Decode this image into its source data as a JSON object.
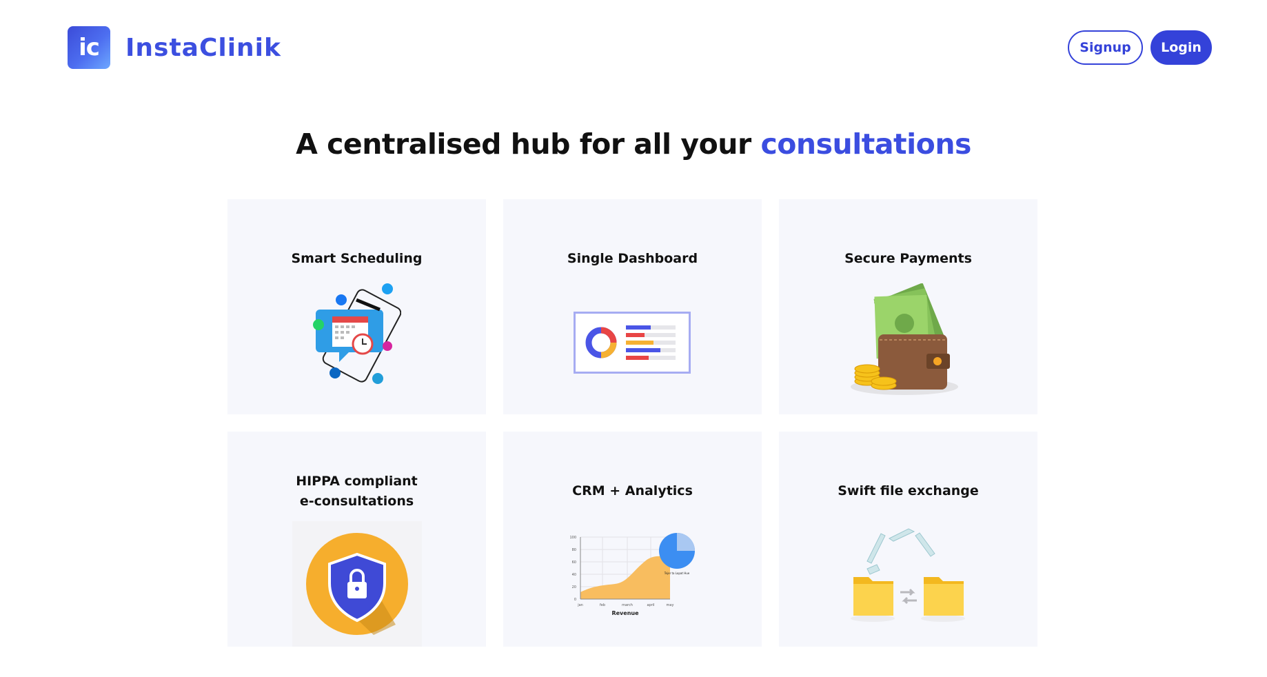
{
  "brand": {
    "logo_mark": "ic",
    "name": "InstaClinik",
    "color": "#3c4fe0"
  },
  "nav": {
    "signup_label": "Signup",
    "login_label": "Login"
  },
  "hero": {
    "headline_main": "A centralised hub for all your ",
    "headline_accent": "consultations",
    "accent_color": "#3b4de0"
  },
  "features": [
    {
      "title": "Smart Scheduling",
      "icon": "calendar-social-icon"
    },
    {
      "title": "Single Dashboard",
      "icon": "dashboard-icon"
    },
    {
      "title": "Secure Payments",
      "icon": "wallet-money-icon"
    },
    {
      "title_line1": "HIPPA compliant",
      "title_line2": "e-consultations",
      "icon": "shield-lock-icon"
    },
    {
      "title": "CRM + Analytics",
      "icon": "analytics-chart-icon"
    },
    {
      "title": "Swift file exchange",
      "icon": "folder-exchange-icon"
    }
  ],
  "analytics_illustration": {
    "y_ticks": [
      "100",
      "80",
      "60",
      "40",
      "20",
      "0"
    ],
    "x_ticks": [
      "jan",
      "feb",
      "march",
      "april",
      "may"
    ],
    "xlabel": "Revenue",
    "pie_label": "Tejer ta Lopat Hue"
  }
}
